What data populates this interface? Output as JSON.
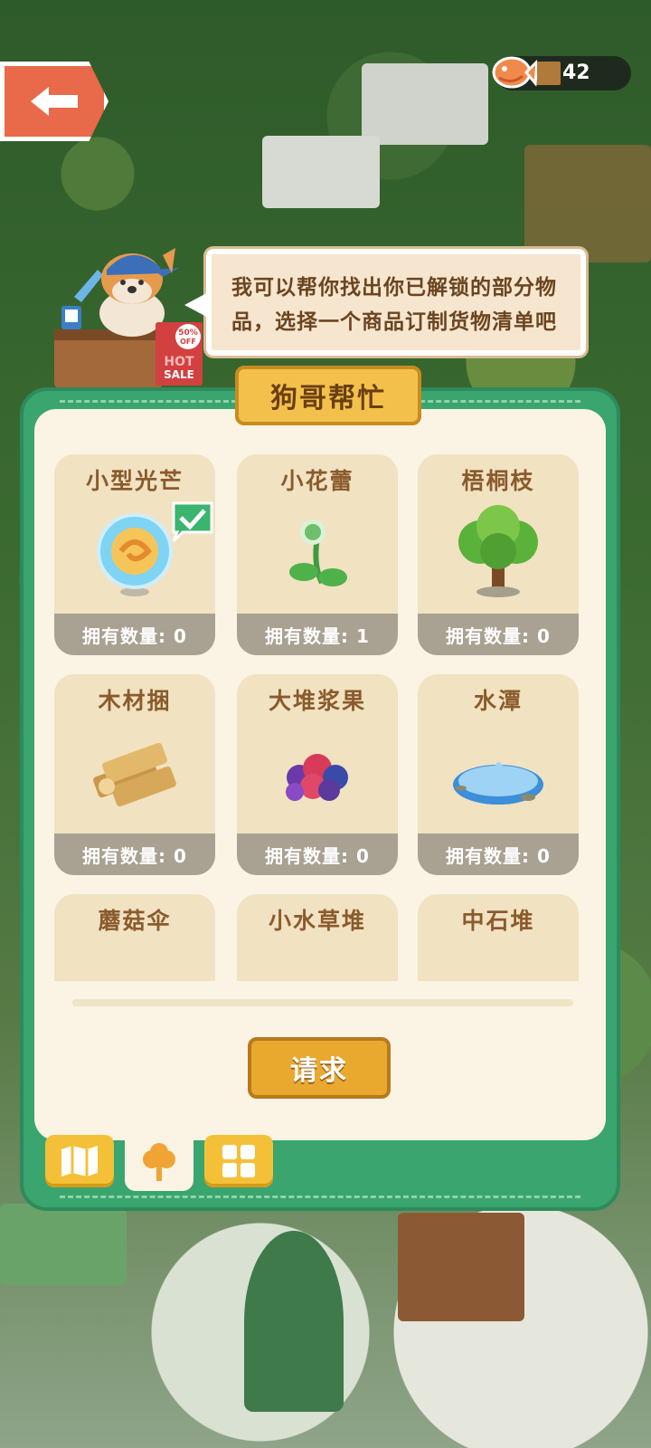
{
  "hud": {
    "currency_value": "42",
    "icons": {
      "back": "back-arrow-icon",
      "currency": "fish-currency-icon"
    }
  },
  "npc": {
    "speech": "我可以帮你找出你已解锁的部分物品，选择一个商品订制货物清单吧",
    "sign_lines": [
      "50%",
      "OFF",
      "HOT",
      "SALE"
    ]
  },
  "panel": {
    "title": "狗哥帮忙",
    "request_label": "请求"
  },
  "items": [
    {
      "name": "小型光芒",
      "count": "拥有数量: 0",
      "icon": "glow-orb-icon",
      "selected": true
    },
    {
      "name": "小花蕾",
      "count": "拥有数量: 1",
      "icon": "flower-bud-icon",
      "selected": false
    },
    {
      "name": "梧桐枝",
      "count": "拥有数量: 0",
      "icon": "tree-icon",
      "selected": false
    },
    {
      "name": "木材捆",
      "count": "拥有数量: 0",
      "icon": "wood-bundle-icon",
      "selected": false
    },
    {
      "name": "大堆浆果",
      "count": "拥有数量: 0",
      "icon": "berries-icon",
      "selected": false
    },
    {
      "name": "水潭",
      "count": "拥有数量: 0",
      "icon": "pond-icon",
      "selected": false
    },
    {
      "name": "蘑菇伞",
      "count": "",
      "icon": "mushroom-icon",
      "selected": false
    },
    {
      "name": "小水草堆",
      "count": "",
      "icon": "water-grass-icon",
      "selected": false
    },
    {
      "name": "中石堆",
      "count": "",
      "icon": "stone-pile-icon",
      "selected": false
    }
  ],
  "tabs": [
    {
      "icon": "map-icon",
      "active": false
    },
    {
      "icon": "tree-tab-icon",
      "active": true
    },
    {
      "icon": "grid-icon",
      "active": false
    }
  ],
  "colors": {
    "panel_green": "#3aa56f",
    "panel_cream": "#fbf4e4",
    "card_bg": "#f1e2c2",
    "title_gold": "#f3c14b",
    "button_gold": "#e9a92f",
    "text_brown": "#8a5b2c"
  }
}
